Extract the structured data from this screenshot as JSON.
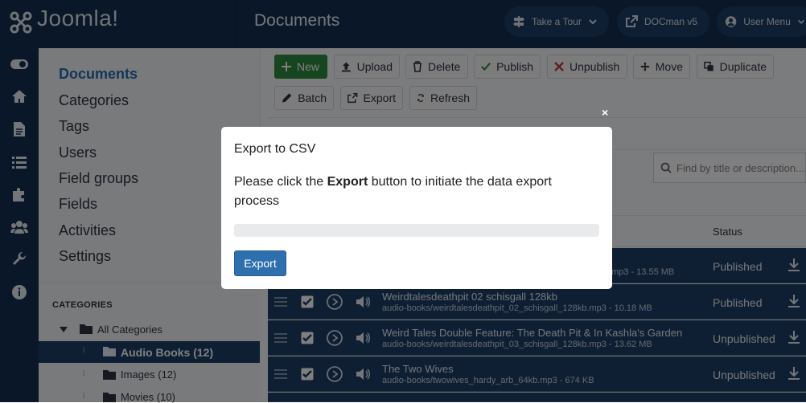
{
  "header": {
    "logo_text": "Joomla!",
    "page_title": "Documents",
    "take_a_tour": "Take a Tour",
    "docman": "DOCman v5",
    "user_menu": "User Menu"
  },
  "sidebar": {
    "items": [
      {
        "label": "Documents",
        "active": true
      },
      {
        "label": "Categories"
      },
      {
        "label": "Tags"
      },
      {
        "label": "Users"
      },
      {
        "label": "Field groups"
      },
      {
        "label": "Fields"
      },
      {
        "label": "Activities"
      },
      {
        "label": "Settings"
      }
    ],
    "categories_heading": "CATEGORIES",
    "tree": [
      {
        "label": "All Categories"
      },
      {
        "label": "Audio Books (12)",
        "selected": true
      },
      {
        "label": "Images (12)"
      },
      {
        "label": "Movies (10)"
      }
    ]
  },
  "toolbar": {
    "new": "New",
    "upload": "Upload",
    "delete": "Delete",
    "publish": "Publish",
    "unpublish": "Unpublish",
    "move": "Move",
    "duplicate": "Duplicate",
    "batch": "Batch",
    "export": "Export",
    "refresh": "Refresh"
  },
  "search": {
    "placeholder": "Find by title or description..."
  },
  "table": {
    "status_header": "Status",
    "rows": [
      {
        "title": "",
        "path": "mp3 - 13.55 MB",
        "status": "Published"
      },
      {
        "title": "Weirdtalesdeathpit 02 schisgall 128kb",
        "path": "audio-books/weirdtalesdeathpit_02_schisgall_128kb.mp3 - 10.18 MB",
        "status": "Published"
      },
      {
        "title": "Weird Tales Double Feature: The Death Pit & In Kashla's Garden",
        "path": "audio-books/weirdtalesdeathpit_03_schisgall_128kb.mp3 - 13.62 MB",
        "status": "Unpublished"
      },
      {
        "title": "The Two Wives",
        "path": "audio-books/twowives_hardy_arb_64kb.mp3 - 674 KB",
        "status": "Unpublished"
      }
    ]
  },
  "modal": {
    "title": "Export to CSV",
    "body_pre": "Please click the ",
    "body_bold": "Export",
    "body_post": " button to initiate the data export process",
    "progress": 0,
    "button": "Export",
    "close": "×"
  },
  "colors": {
    "header": "#132f53",
    "accent": "#2a6bb5",
    "new_button": "#2e8b3e"
  }
}
